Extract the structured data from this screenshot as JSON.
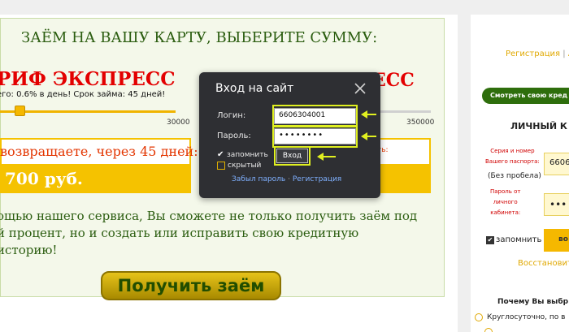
{
  "main": {
    "headline": "ЗАЁМ НА ВАШУ КАРТУ, ВЫБЕРИТЕ СУММУ:",
    "tariff": "РИФ ЭКСПРЕСС",
    "tariff_right": "ЕСС",
    "rate": "его: 0.6% в день! Срок займа: 45 дней!",
    "slider_left_max": "30000",
    "slider_right_max": "350000",
    "return_label": "возвращаете, через 45 дней:",
    "amount": "700 руб.",
    "right_box_label": "ть:",
    "description": "ощью нашего сервиса, Вы сможете не только получить заём под й процент, но и создать или исправить свою кредитную историю!",
    "cta_label": "Получить заём"
  },
  "sidebar": {
    "register": "Регистрация",
    "separator": "|",
    "login_partial": "А",
    "check_button": "Смотреть свою кред",
    "cabinet_title": "ЛИЧНЫЙ К",
    "passport_label_1": "Серия и номер",
    "passport_label_2": "Вашего паспорта:",
    "no_space": "(Без пробела)",
    "passport_value": "6606",
    "password_label_1": "Пароль от",
    "password_label_2": "личного",
    "password_label_3": "кабинета:",
    "password_value": "•••",
    "remember": "запомнить",
    "submit_partial": "во",
    "restore": "Восстановит",
    "why_title": "Почему Вы выбр",
    "why_item_1": "Круглосуточно, по в"
  },
  "modal": {
    "title": "Вход на сайт",
    "login_label": "Логин:",
    "login_value": "6606304001",
    "password_label": "Пароль:",
    "password_value": "••••••••",
    "remember_label": "запомнить",
    "hidden_label": "скрытый",
    "submit_label": "Вход",
    "forgot_link": "Забыл пароль",
    "link_separator": "·",
    "register_link": "Регистрация"
  },
  "colors": {
    "headline": "#2b5d10",
    "tariff": "#e30000",
    "accent_yellow": "#f5c200",
    "highlight": "#e0f020",
    "modal_bg": "#2e2f33",
    "link_blue": "#7fb0ff"
  },
  "icons": {
    "close": "close-icon",
    "arrow": "arrow-left-icon"
  }
}
